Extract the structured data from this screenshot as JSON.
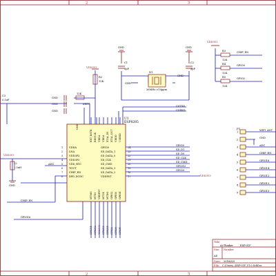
{
  "border": {
    "zone_numbers": [
      "2",
      "3"
    ]
  },
  "ic": {
    "ref": "U1",
    "part": "ESP8285",
    "left_pins": [
      {
        "num": "1",
        "name": "VDDA"
      },
      {
        "num": "2",
        "name": "LNA"
      },
      {
        "num": "3",
        "name": "VDD3P3"
      },
      {
        "num": "4",
        "name": "VDD3P3"
      },
      {
        "num": "5",
        "name": "VDD_RTC"
      },
      {
        "num": "6",
        "name": "TOUT"
      },
      {
        "num": "7",
        "name": "CHIP_EN"
      },
      {
        "num": "8",
        "name": "XPD_DCDC"
      }
    ],
    "top_pins": [
      {
        "num": "32",
        "name": "EXT_RSTB"
      },
      {
        "num": "31",
        "name": "RES12K"
      },
      {
        "num": "30",
        "name": "VDDA"
      },
      {
        "num": "29",
        "name": "VDDA"
      },
      {
        "num": "28",
        "name": "XTAL_IN"
      },
      {
        "num": "27",
        "name": "XTAL_OUT"
      },
      {
        "num": "26",
        "name": "VDDD"
      },
      {
        "num": "25",
        "name": "U0RXD"
      }
    ],
    "right_pins": [
      {
        "num": "24",
        "name": "GPIO5"
      },
      {
        "num": "23",
        "name": "SD_DATA_1"
      },
      {
        "num": "22",
        "name": "SD_DATA_0"
      },
      {
        "num": "21",
        "name": "SD_CLK"
      },
      {
        "num": "20",
        "name": "SD_CMD"
      },
      {
        "num": "19",
        "name": "SD_DATA_3"
      },
      {
        "num": "18",
        "name": "SD_DATA_2"
      },
      {
        "num": "17",
        "name": "VDDPST"
      }
    ],
    "bottom_pins": [
      "MTMS",
      "MTDI",
      "VDDPST",
      "MTCK",
      "MTDO",
      "GPIO2",
      "GPIO0",
      "GPIO4"
    ],
    "bottom_pin_nums": [
      "9",
      "10",
      "11",
      "12",
      "13",
      "14",
      "15",
      "16"
    ],
    "gnd_pin": "GND",
    "gnd_num": "33"
  },
  "crystal": {
    "ref": "X1",
    "spec": "26MHz ±10ppm"
  },
  "caps": {
    "c1": {
      "ref": "C1",
      "value": "5pF"
    },
    "c2": {
      "ref": "C2",
      "value": "5pF"
    },
    "c3": {
      "ref": "C3",
      "value": "0.1uF"
    },
    "c4": {
      "ref": "C4",
      "value": "1uF"
    }
  },
  "resistors": {
    "r1": {
      "ref": "R1",
      "value": "12K"
    },
    "r2": {
      "ref": "R2",
      "value": "12K"
    },
    "r_res": {
      "value": "12K"
    },
    "r3": {
      "ref": "R3",
      "value": "12K"
    },
    "r4": {
      "ref": "R4",
      "value": "12K"
    },
    "r5": {
      "ref": "R5",
      "value": "12K"
    }
  },
  "inductor": {
    "ref": "L2",
    "value": "1.5nH"
  },
  "nets": {
    "gnd": "GND",
    "vdd3v3": "VDD3V3",
    "u0txd": "U0TXD",
    "u0rxd": "U0RXD",
    "adc": "ADC",
    "chip_en": "CHIP_EN",
    "gpio16": "GPIO16",
    "gpio0": "GPIO0",
    "gpio2": "GPIO2",
    "rst": "nRST",
    "gpio5": "GPIO5",
    "sd_d1": "SD_D1",
    "sd_d0": "SD_D0",
    "sd_clk": "SD_CLK",
    "sd_cmd": "SD_CMD",
    "gpio10": "GPIO10",
    "gpio9": "GPIO9",
    "vdd_bottom": [
      "GPIO14",
      "GPIO12",
      "VDD3V3",
      "GPIO13",
      "GPIO15",
      "GPIO2",
      "GPIO0",
      "GPIO4"
    ]
  },
  "header": {
    "ref": "P1",
    "pins": [
      {
        "num": "1",
        "net": "WIFI_ANT"
      },
      {
        "num": "2",
        "net": "GND"
      },
      {
        "num": "3",
        "net": "ADC"
      },
      {
        "num": "4",
        "net": "CHIP_EN"
      },
      {
        "num": "5",
        "net": "GPIO16"
      },
      {
        "num": "6",
        "net": "GPIO14"
      },
      {
        "num": "7",
        "net": "GPIO12"
      },
      {
        "num": "8",
        "net": "GPIO13"
      },
      {
        "num": "9",
        "net": "GPIO15"
      }
    ]
  },
  "title_block": {
    "title_label": "Title",
    "company": "Ai-Thinker",
    "project": "ESP-01F",
    "size_label": "Size",
    "size": "A4",
    "number_label": "Number",
    "date_label": "Date:",
    "date": "2018/6/5",
    "file_label": "File:",
    "file": "C:\\Users\\..\\ESP-01F_V1.0.SchDoc"
  }
}
